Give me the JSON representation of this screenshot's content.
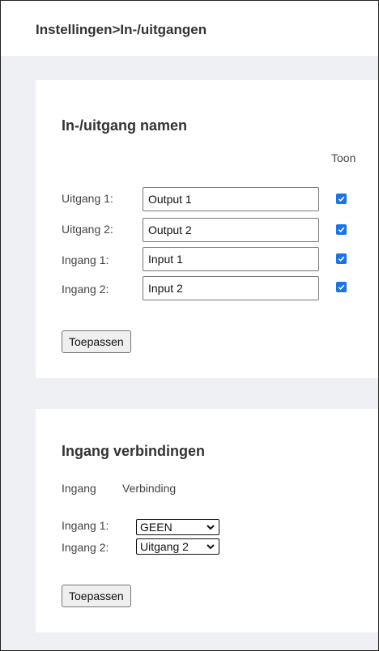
{
  "header": {
    "breadcrumb": "Instellingen>In-/uitgangen"
  },
  "names_section": {
    "title": "In-/uitgang namen",
    "show_header": "Toon",
    "rows": [
      {
        "label": "Uitgang 1:",
        "value": "Output 1",
        "show": true
      },
      {
        "label": "Uitgang 2:",
        "value": "Output 2",
        "show": true
      },
      {
        "label": "Ingang 1:",
        "value": "Input 1",
        "show": true
      },
      {
        "label": "Ingang 2:",
        "value": "Input 2",
        "show": true
      }
    ],
    "apply_label": "Toepassen"
  },
  "connections_section": {
    "title": "Ingang verbindingen",
    "col_input": "Ingang",
    "col_connection": "Verbinding",
    "rows": [
      {
        "label": "Ingang 1:",
        "selected": "GEEN"
      },
      {
        "label": "Ingang 2:",
        "selected": "Uitgang 2"
      }
    ],
    "apply_label": "Toepassen"
  },
  "colors": {
    "accent": "#1a73e8",
    "background": "#eef0f3"
  }
}
